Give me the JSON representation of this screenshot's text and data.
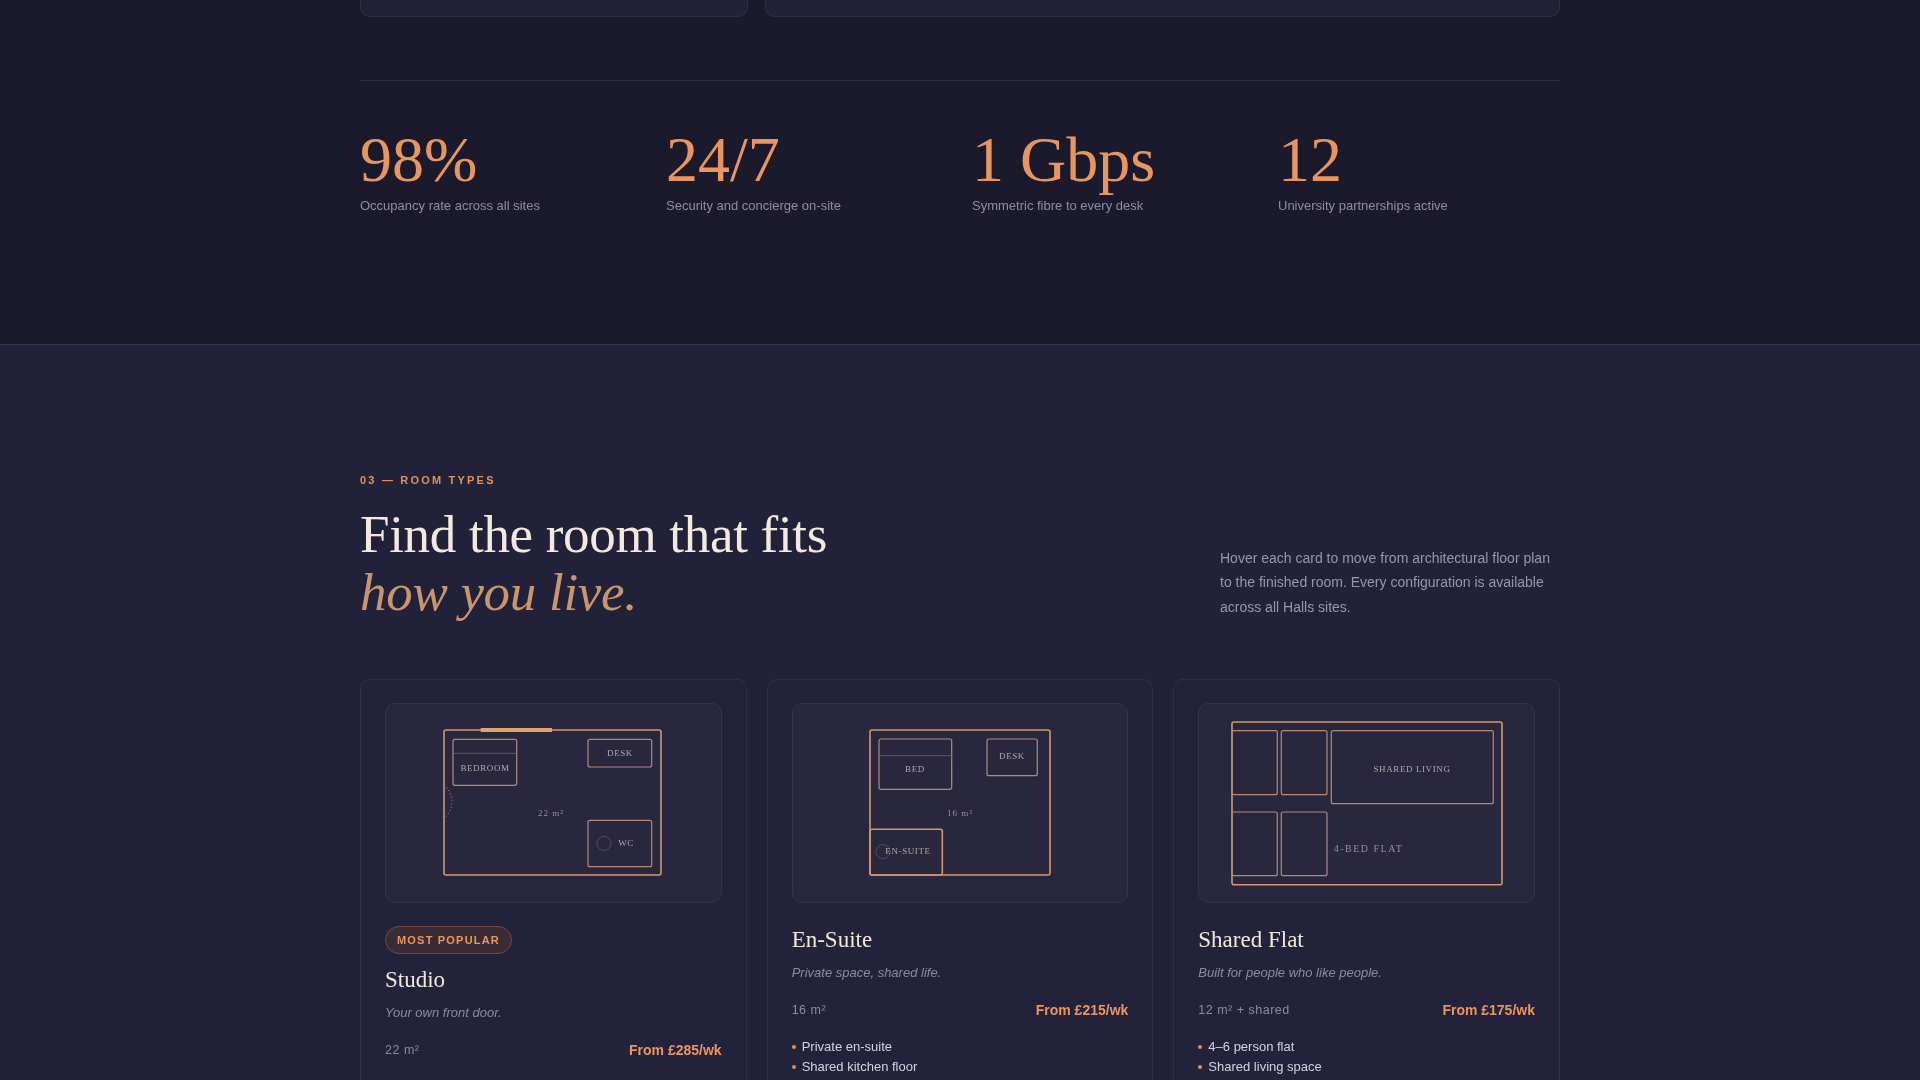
{
  "stats": [
    {
      "value": "98%",
      "label": "Occupancy rate across all sites"
    },
    {
      "value": "24/7",
      "label": "Security and concierge on-site"
    },
    {
      "value": "1 Gbps",
      "label": "Symmetric fibre to every desk"
    },
    {
      "value": "12",
      "label": "University partnerships active"
    }
  ],
  "room_types": {
    "eyebrow": "03 — ROOM TYPES",
    "heading": "Find the room that fits *how you live.*",
    "intro": "Hover each card to move from architectural floor plan to the finished room. Every configuration is available across all Halls sites.",
    "cards": [
      {
        "plan": {
          "kind": "studio",
          "labels": [
            "BEDROOM",
            "DESK",
            "WC"
          ],
          "caption": "22 m²"
        },
        "badge": "MOST POPULAR",
        "title": "Studio",
        "tagline": "Your own front door.",
        "size": "22 m²",
        "price": "From £285/wk"
      },
      {
        "plan": {
          "kind": "ensuite",
          "labels": [
            "BED",
            "DESK",
            "EN-SUITE"
          ],
          "caption": "16 m²"
        },
        "title": "En-Suite",
        "tagline": "Private space, shared life.",
        "size": "16 m²",
        "price": "From £215/wk",
        "features": [
          "Private en-suite",
          "Shared kitchen floor"
        ]
      },
      {
        "plan": {
          "kind": "flat",
          "labels": [
            "SHARED LIVING"
          ],
          "caption": "4-BED FLAT"
        },
        "title": "Shared Flat",
        "tagline": "Built for people who like people.",
        "size": "12 m² + shared",
        "price": "From £175/wk",
        "features": [
          "4–6 person flat",
          "Shared living space"
        ]
      }
    ]
  }
}
